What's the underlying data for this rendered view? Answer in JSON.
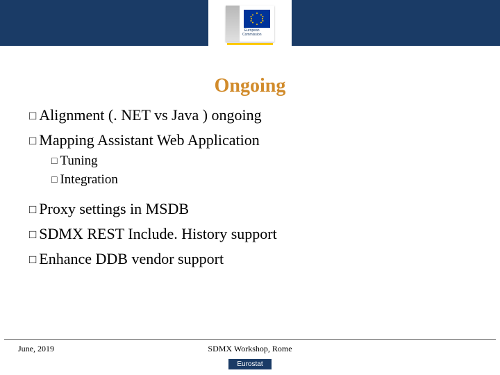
{
  "header": {
    "logo_line1": "European",
    "logo_line2": "Commission"
  },
  "title": "Ongoing",
  "bullets": [
    {
      "text": "Alignment (. NET vs Java ) ongoing"
    },
    {
      "text": "Mapping Assistant Web Application",
      "sub": [
        {
          "text": "Tuning"
        },
        {
          "text": "Integration"
        }
      ]
    }
  ],
  "bullets2": [
    {
      "text": "Proxy settings in MSDB"
    },
    {
      "text": "SDMX REST Include. History support"
    },
    {
      "text": "Enhance DDB vendor support"
    }
  ],
  "footer": {
    "left": "June, 2019",
    "center": "SDMX Workshop, Rome",
    "badge": "Eurostat"
  }
}
